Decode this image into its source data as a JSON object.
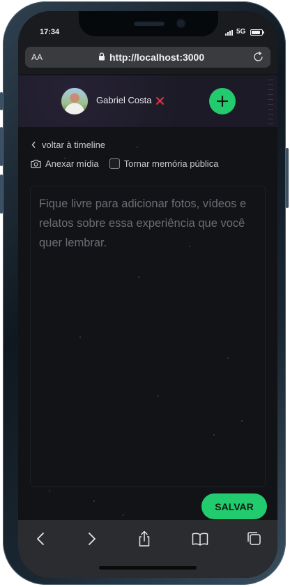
{
  "status_bar": {
    "time": "17:34",
    "network": "5G"
  },
  "browser": {
    "text_size_label": "AA",
    "url": "http://localhost:3000",
    "icons": {
      "lock": "lock-icon",
      "reload": "reload-icon"
    }
  },
  "header": {
    "user_name": "Gabriel Costa",
    "icons": {
      "logout": "close-icon",
      "add": "plus-icon"
    },
    "accent_color": "#22cc6e",
    "logout_color": "#e5343d"
  },
  "content": {
    "back_label": "voltar à timeline",
    "attach_label": "Anexar mídia",
    "public_label": "Tornar memória pública",
    "public_checked": false,
    "memory_value": "",
    "memory_placeholder": "Fique livre para adicionar fotos, vídeos e relatos sobre essa experiência que você quer lembrar.",
    "save_label": "SALVAR",
    "icons": {
      "back": "chevron-left-icon",
      "attach": "camera-icon"
    }
  },
  "toolbar": {
    "icons": [
      "back-icon",
      "forward-icon",
      "share-icon",
      "bookmarks-icon",
      "tabs-icon"
    ]
  }
}
